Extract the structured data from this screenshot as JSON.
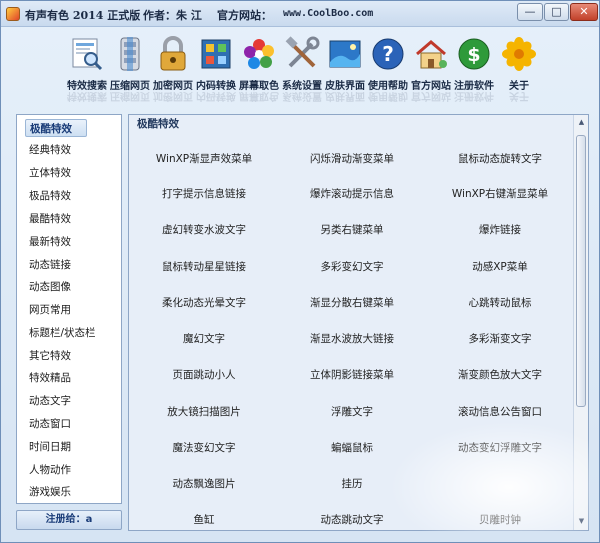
{
  "window": {
    "title_app": "有声有色 2014 正式版",
    "title_author": "作者：朱 江",
    "title_site_label": "官方网站：",
    "title_site_url": "www.CoolBoo.com",
    "min": "—",
    "max": "□",
    "close": "✕"
  },
  "toolbar": [
    {
      "label": "特效搜索",
      "icon": "search-page-icon"
    },
    {
      "label": "压缩网页",
      "icon": "compress-icon"
    },
    {
      "label": "加密网页",
      "icon": "lock-icon"
    },
    {
      "label": "内码转换",
      "icon": "code-convert-icon"
    },
    {
      "label": "屏幕取色",
      "icon": "color-picker-icon"
    },
    {
      "label": "系统设置",
      "icon": "tools-icon"
    },
    {
      "label": "皮肤界面",
      "icon": "skin-icon"
    },
    {
      "label": "使用帮助",
      "icon": "help-icon"
    },
    {
      "label": "官方网站",
      "icon": "home-icon"
    },
    {
      "label": "注册软件",
      "icon": "dollar-icon"
    },
    {
      "label": "关于",
      "icon": "flower-icon"
    }
  ],
  "sidebar": {
    "items": [
      "极酷特效",
      "经典特效",
      "立体特效",
      "极品特效",
      "最酷特效",
      "最新特效",
      "动态链接",
      "动态图像",
      "网页常用",
      "标题栏/状态栏",
      "其它特效",
      "特效精品",
      "动态文字",
      "动态窗口",
      "时间日期",
      "人物动作",
      "游戏娱乐"
    ],
    "selected_index": 0
  },
  "register": {
    "label": "注册给：a"
  },
  "main": {
    "title": "极酷特效",
    "rows": [
      [
        "WinXP渐显声效菜单",
        "闪烁滑动渐变菜单",
        "鼠标动态旋转文字"
      ],
      [
        "打字提示信息链接",
        "爆炸滚动提示信息",
        "WinXP右键渐显菜单"
      ],
      [
        "虚幻转变水波文字",
        "另类右键菜单",
        "爆炸链接"
      ],
      [
        "鼠标转动星星链接",
        "多彩变幻文字",
        "动感XP菜单"
      ],
      [
        "柔化动态光晕文字",
        "渐显分散右键菜单",
        "心跳转动鼠标"
      ],
      [
        "魔幻文字",
        "渐显水波放大链接",
        "多彩渐变文字"
      ],
      [
        "页面跳动小人",
        "立体阴影链接菜单",
        "渐变颜色放大文字"
      ],
      [
        "放大镜扫描图片",
        "浮雕文字",
        "滚动信息公告窗口"
      ],
      [
        "魔法变幻文字",
        "蝙蝠鼠标",
        "动态变幻浮雕文字"
      ],
      [
        "动态飘逸图片",
        "挂历",
        ""
      ],
      [
        "鱼缸",
        "动态跳动文字",
        "贝雕时钟"
      ]
    ]
  }
}
